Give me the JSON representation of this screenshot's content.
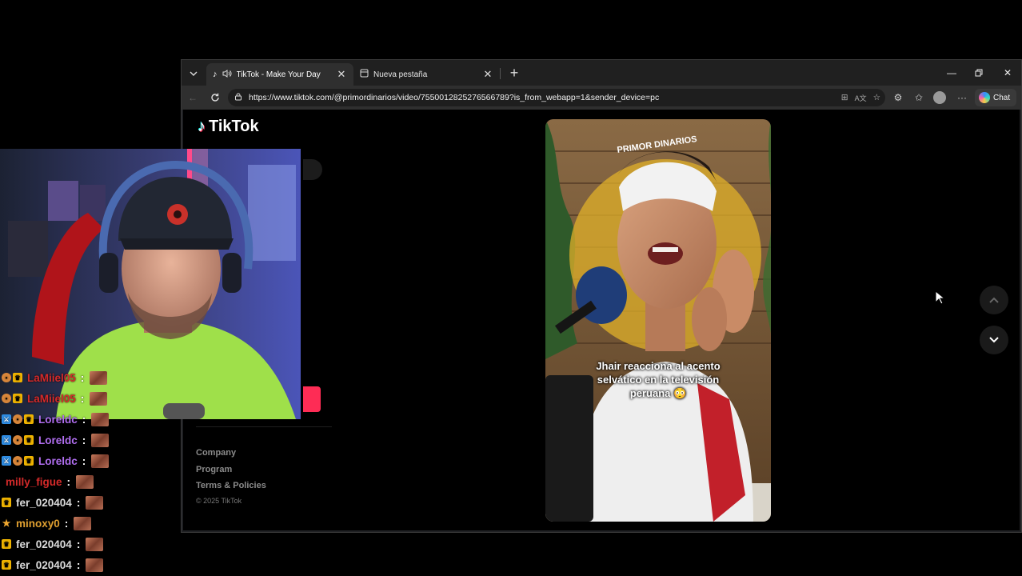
{
  "browser": {
    "tabs": [
      {
        "title": "TikTok - Make Your Day",
        "active": true,
        "audio": true
      },
      {
        "title": "Nueva pestaña",
        "active": false
      }
    ],
    "new_tab": "+",
    "url": "https://www.tiktok.com/@primordinarios/video/7550012825276566789?is_from_webapp=1&sender_device=pc",
    "chat_button": "Chat"
  },
  "page": {
    "logo_text": "TikTok",
    "footer_links": [
      "Company",
      "Program",
      "Terms & Policies"
    ],
    "copyright": "© 2025 TikTok",
    "video": {
      "caption": "Jhair reacciona al acento selvático en la televisión peruana 😳",
      "watermark": "PRIMOR DINARIOS"
    }
  },
  "chat": {
    "messages": [
      {
        "user": "LaMiiel05",
        "color": "#d52a2a",
        "badges": [
          "cat",
          "crown"
        ]
      },
      {
        "user": "LaMiiel05",
        "color": "#d52a2a",
        "badges": [
          "cat",
          "crown"
        ]
      },
      {
        "user": "Loreldc",
        "color": "#b06ef0",
        "badges": [
          "mod",
          "cat",
          "crown"
        ]
      },
      {
        "user": "Loreldc",
        "color": "#b06ef0",
        "badges": [
          "mod",
          "cat",
          "crown"
        ]
      },
      {
        "user": "Loreldc",
        "color": "#b06ef0",
        "badges": [
          "mod",
          "cat",
          "crown"
        ]
      },
      {
        "user": "milly_figue",
        "color": "#d52a2a",
        "badges": []
      },
      {
        "user": "fer_020404",
        "color": "#dcdcdc",
        "badges": [
          "crown"
        ]
      },
      {
        "user": "minoxy0",
        "color": "#e0a030",
        "badges": [
          "star"
        ]
      },
      {
        "user": "fer_020404",
        "color": "#dcdcdc",
        "badges": [
          "crown"
        ]
      },
      {
        "user": "fer_020404",
        "color": "#dcdcdc",
        "badges": [
          "crown"
        ]
      }
    ]
  },
  "colors": {
    "tiktok_red": "#fe2c55",
    "tiktok_cyan": "#25f4ee"
  }
}
